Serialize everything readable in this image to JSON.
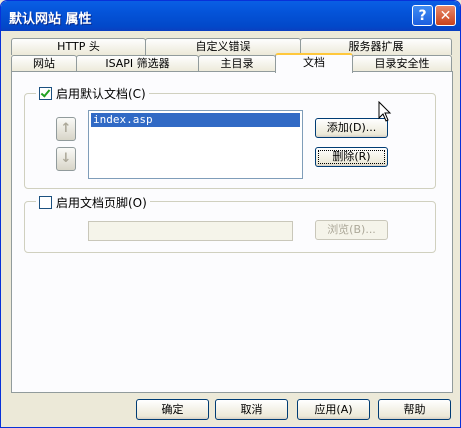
{
  "window": {
    "title": "默认网站 属性",
    "help_icon": "?",
    "close_icon": "✕"
  },
  "tabs_row_top": [
    "HTTP 头",
    "自定义错误",
    "服务器扩展"
  ],
  "tabs_row_bottom": [
    "网站",
    "ISAPI 筛选器",
    "主目录",
    "文档",
    "目录安全性"
  ],
  "active_tab": "文档",
  "default_doc": {
    "label": "启用默认文档(C)",
    "checked": true,
    "items": [
      "index.asp"
    ],
    "move_up_icon": "↑",
    "move_down_icon": "↓",
    "add_button": "添加(D)...",
    "remove_button": "删除(R)"
  },
  "footer_doc": {
    "label": "启用文档页脚(O)",
    "checked": false,
    "path_value": "",
    "browse_button": "浏览(B)..."
  },
  "buttons": {
    "ok": "确定",
    "cancel": "取消",
    "apply": "应用(A)",
    "help": "帮助"
  }
}
